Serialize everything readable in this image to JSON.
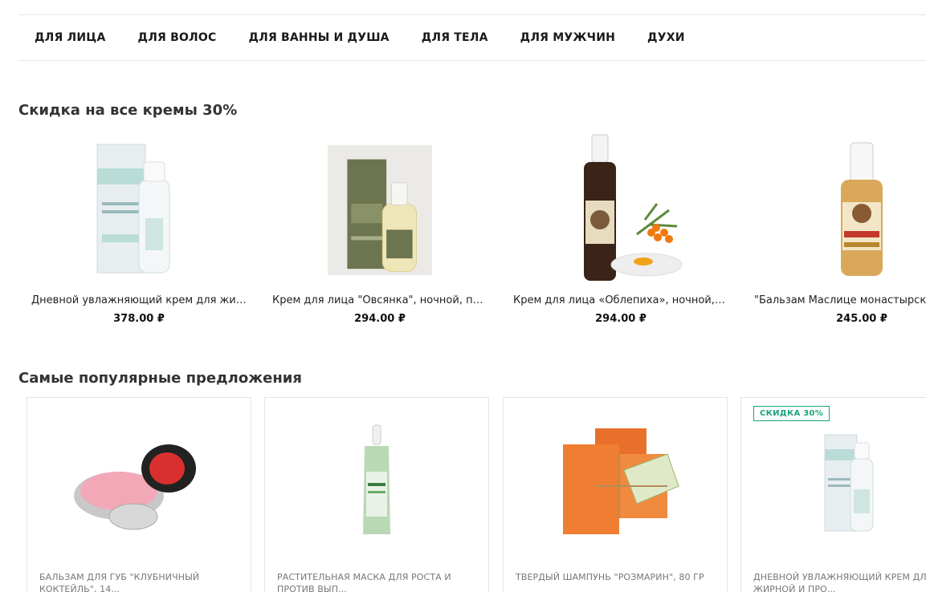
{
  "nav": {
    "items": [
      "ДЛЯ ЛИЦА",
      "ДЛЯ ВОЛОС",
      "ДЛЯ ВАННЫ И ДУША",
      "ДЛЯ ТЕЛА",
      "ДЛЯ МУЖЧИН",
      "ДУХИ"
    ]
  },
  "sale_section": {
    "title": "Скидка на все кремы 30%",
    "items": [
      {
        "name": "Дневной увлажняющий крем для жирной и проблемной кожи",
        "price": "378.00 ₽",
        "image": "face-cream-day-bottle"
      },
      {
        "name": "Крем для лица \"Овсянка\", ночной, питательный",
        "price": "294.00 ₽",
        "image": "face-cream-oat-bottle"
      },
      {
        "name": "Крем для лица «Облепиха», ночной, питательный",
        "price": "294.00 ₽",
        "image": "face-cream-sea-buckthorn-bottle"
      },
      {
        "name": "\"Бальзам Маслице монастырское\"",
        "price": "245.00 ₽",
        "image": "balm-maslitse-bottle"
      }
    ]
  },
  "popular_section": {
    "title": "Самые популярные предложения",
    "items": [
      {
        "name": "БАЛЬЗАМ ДЛЯ ГУБ \"КЛУБНИЧНЫЙ КОКТЕЙЛЬ\", 14...",
        "image": "lip-balm-tin",
        "badge": ""
      },
      {
        "name": "РАСТИТЕЛЬНАЯ МАСКА ДЛЯ РОСТА И ПРОТИВ ВЫП...",
        "image": "hair-mask-bottle",
        "badge": ""
      },
      {
        "name": "ТВЕРДЫЙ ШАМПУНЬ \"РОЗМАРИН\", 80 ГР",
        "image": "solid-shampoo-bar",
        "badge": ""
      },
      {
        "name": "ДНЕВНОЙ УВЛАЖНЯЮЩИЙ КРЕМ ДЛЯ ЖИРНОЙ И ПРО...",
        "image": "face-cream-day-bottle",
        "badge": "СКИДКА 30%"
      }
    ]
  },
  "colors": {
    "accent": "#1ca37c",
    "border": "#e4e4e4"
  }
}
